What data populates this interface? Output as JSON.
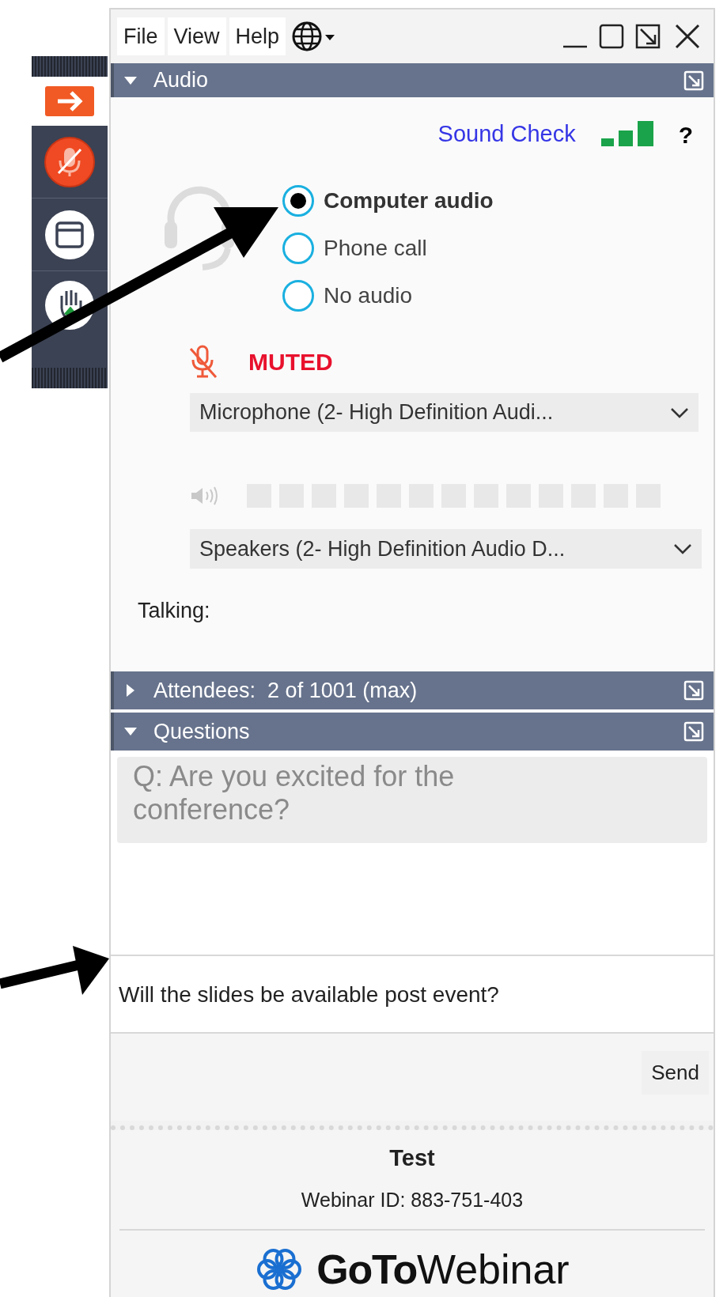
{
  "menu": [
    {
      "label": "File"
    },
    {
      "label": "View"
    },
    {
      "label": "Help"
    }
  ],
  "audio": {
    "title": "Audio",
    "expanded": true,
    "sound_check": "Sound Check",
    "help": "?",
    "options": [
      {
        "label": "Computer audio",
        "selected": true
      },
      {
        "label": "Phone call",
        "selected": false
      },
      {
        "label": "No audio",
        "selected": false
      }
    ],
    "mute_status": "MUTED",
    "microphone": "Microphone (2- High Definition Audi...",
    "speaker_meter": {
      "level": 0
    },
    "speakers": "Speakers (2- High Definition Audio D...",
    "talking": "Talking:"
  },
  "attendees": {
    "title": "Attendees:  2 of 1001 (max)",
    "expanded": false
  },
  "questions": {
    "title": "Questions",
    "expanded": true,
    "items": [
      {
        "text": "Q: Are you excited for the conference?"
      }
    ],
    "input": {
      "value": "Will the slides be available post event?"
    },
    "send": "Send"
  },
  "footer": {
    "title": "Test",
    "webinar_id": "Webinar ID: 883-751-403",
    "logo_bold": "GoTo",
    "logo_light": "Webinar"
  }
}
